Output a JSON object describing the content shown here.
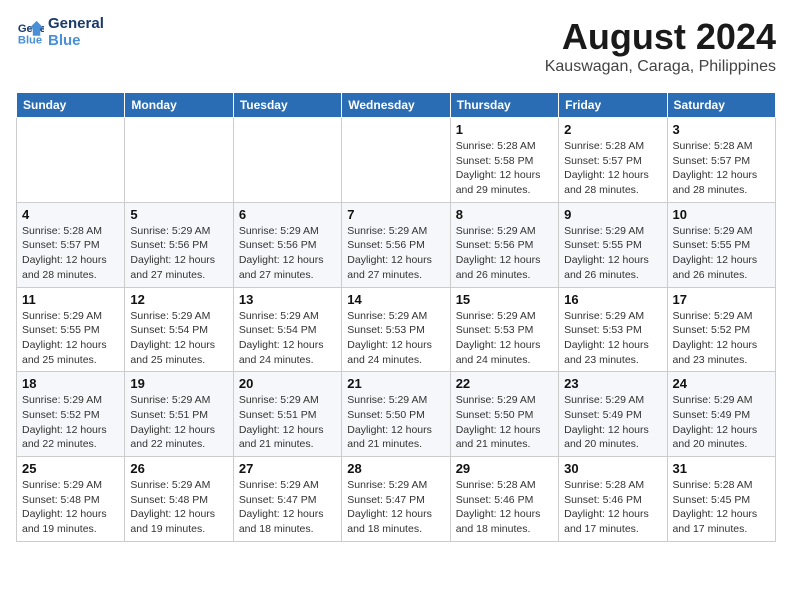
{
  "header": {
    "logo_line1": "General",
    "logo_line2": "Blue",
    "month": "August 2024",
    "location": "Kauswagan, Caraga, Philippines"
  },
  "weekdays": [
    "Sunday",
    "Monday",
    "Tuesday",
    "Wednesday",
    "Thursday",
    "Friday",
    "Saturday"
  ],
  "weeks": [
    [
      {
        "day": "",
        "sunrise": "",
        "sunset": "",
        "daylight": ""
      },
      {
        "day": "",
        "sunrise": "",
        "sunset": "",
        "daylight": ""
      },
      {
        "day": "",
        "sunrise": "",
        "sunset": "",
        "daylight": ""
      },
      {
        "day": "",
        "sunrise": "",
        "sunset": "",
        "daylight": ""
      },
      {
        "day": "1",
        "sunrise": "Sunrise: 5:28 AM",
        "sunset": "Sunset: 5:58 PM",
        "daylight": "Daylight: 12 hours and 29 minutes."
      },
      {
        "day": "2",
        "sunrise": "Sunrise: 5:28 AM",
        "sunset": "Sunset: 5:57 PM",
        "daylight": "Daylight: 12 hours and 28 minutes."
      },
      {
        "day": "3",
        "sunrise": "Sunrise: 5:28 AM",
        "sunset": "Sunset: 5:57 PM",
        "daylight": "Daylight: 12 hours and 28 minutes."
      }
    ],
    [
      {
        "day": "4",
        "sunrise": "Sunrise: 5:28 AM",
        "sunset": "Sunset: 5:57 PM",
        "daylight": "Daylight: 12 hours and 28 minutes."
      },
      {
        "day": "5",
        "sunrise": "Sunrise: 5:29 AM",
        "sunset": "Sunset: 5:56 PM",
        "daylight": "Daylight: 12 hours and 27 minutes."
      },
      {
        "day": "6",
        "sunrise": "Sunrise: 5:29 AM",
        "sunset": "Sunset: 5:56 PM",
        "daylight": "Daylight: 12 hours and 27 minutes."
      },
      {
        "day": "7",
        "sunrise": "Sunrise: 5:29 AM",
        "sunset": "Sunset: 5:56 PM",
        "daylight": "Daylight: 12 hours and 27 minutes."
      },
      {
        "day": "8",
        "sunrise": "Sunrise: 5:29 AM",
        "sunset": "Sunset: 5:56 PM",
        "daylight": "Daylight: 12 hours and 26 minutes."
      },
      {
        "day": "9",
        "sunrise": "Sunrise: 5:29 AM",
        "sunset": "Sunset: 5:55 PM",
        "daylight": "Daylight: 12 hours and 26 minutes."
      },
      {
        "day": "10",
        "sunrise": "Sunrise: 5:29 AM",
        "sunset": "Sunset: 5:55 PM",
        "daylight": "Daylight: 12 hours and 26 minutes."
      }
    ],
    [
      {
        "day": "11",
        "sunrise": "Sunrise: 5:29 AM",
        "sunset": "Sunset: 5:55 PM",
        "daylight": "Daylight: 12 hours and 25 minutes."
      },
      {
        "day": "12",
        "sunrise": "Sunrise: 5:29 AM",
        "sunset": "Sunset: 5:54 PM",
        "daylight": "Daylight: 12 hours and 25 minutes."
      },
      {
        "day": "13",
        "sunrise": "Sunrise: 5:29 AM",
        "sunset": "Sunset: 5:54 PM",
        "daylight": "Daylight: 12 hours and 24 minutes."
      },
      {
        "day": "14",
        "sunrise": "Sunrise: 5:29 AM",
        "sunset": "Sunset: 5:53 PM",
        "daylight": "Daylight: 12 hours and 24 minutes."
      },
      {
        "day": "15",
        "sunrise": "Sunrise: 5:29 AM",
        "sunset": "Sunset: 5:53 PM",
        "daylight": "Daylight: 12 hours and 24 minutes."
      },
      {
        "day": "16",
        "sunrise": "Sunrise: 5:29 AM",
        "sunset": "Sunset: 5:53 PM",
        "daylight": "Daylight: 12 hours and 23 minutes."
      },
      {
        "day": "17",
        "sunrise": "Sunrise: 5:29 AM",
        "sunset": "Sunset: 5:52 PM",
        "daylight": "Daylight: 12 hours and 23 minutes."
      }
    ],
    [
      {
        "day": "18",
        "sunrise": "Sunrise: 5:29 AM",
        "sunset": "Sunset: 5:52 PM",
        "daylight": "Daylight: 12 hours and 22 minutes."
      },
      {
        "day": "19",
        "sunrise": "Sunrise: 5:29 AM",
        "sunset": "Sunset: 5:51 PM",
        "daylight": "Daylight: 12 hours and 22 minutes."
      },
      {
        "day": "20",
        "sunrise": "Sunrise: 5:29 AM",
        "sunset": "Sunset: 5:51 PM",
        "daylight": "Daylight: 12 hours and 21 minutes."
      },
      {
        "day": "21",
        "sunrise": "Sunrise: 5:29 AM",
        "sunset": "Sunset: 5:50 PM",
        "daylight": "Daylight: 12 hours and 21 minutes."
      },
      {
        "day": "22",
        "sunrise": "Sunrise: 5:29 AM",
        "sunset": "Sunset: 5:50 PM",
        "daylight": "Daylight: 12 hours and 21 minutes."
      },
      {
        "day": "23",
        "sunrise": "Sunrise: 5:29 AM",
        "sunset": "Sunset: 5:49 PM",
        "daylight": "Daylight: 12 hours and 20 minutes."
      },
      {
        "day": "24",
        "sunrise": "Sunrise: 5:29 AM",
        "sunset": "Sunset: 5:49 PM",
        "daylight": "Daylight: 12 hours and 20 minutes."
      }
    ],
    [
      {
        "day": "25",
        "sunrise": "Sunrise: 5:29 AM",
        "sunset": "Sunset: 5:48 PM",
        "daylight": "Daylight: 12 hours and 19 minutes."
      },
      {
        "day": "26",
        "sunrise": "Sunrise: 5:29 AM",
        "sunset": "Sunset: 5:48 PM",
        "daylight": "Daylight: 12 hours and 19 minutes."
      },
      {
        "day": "27",
        "sunrise": "Sunrise: 5:29 AM",
        "sunset": "Sunset: 5:47 PM",
        "daylight": "Daylight: 12 hours and 18 minutes."
      },
      {
        "day": "28",
        "sunrise": "Sunrise: 5:29 AM",
        "sunset": "Sunset: 5:47 PM",
        "daylight": "Daylight: 12 hours and 18 minutes."
      },
      {
        "day": "29",
        "sunrise": "Sunrise: 5:28 AM",
        "sunset": "Sunset: 5:46 PM",
        "daylight": "Daylight: 12 hours and 18 minutes."
      },
      {
        "day": "30",
        "sunrise": "Sunrise: 5:28 AM",
        "sunset": "Sunset: 5:46 PM",
        "daylight": "Daylight: 12 hours and 17 minutes."
      },
      {
        "day": "31",
        "sunrise": "Sunrise: 5:28 AM",
        "sunset": "Sunset: 5:45 PM",
        "daylight": "Daylight: 12 hours and 17 minutes."
      }
    ]
  ]
}
